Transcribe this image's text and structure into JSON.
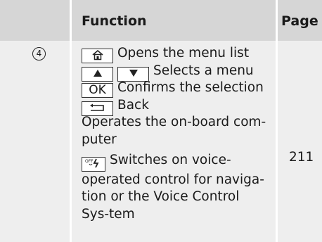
{
  "table": {
    "headers": {
      "number": "",
      "function": "Function",
      "page": "Page"
    },
    "row": {
      "number": "④",
      "lines": {
        "menu_list": "Opens the menu list",
        "selects": "Selects a menu",
        "confirms": "Confirms the selection",
        "back": "Back",
        "onboard": "Operates the on-board com-puter",
        "voice": "Switches on voice-operated control for naviga-tion or the Voice Control Sys-tem"
      },
      "keys": {
        "home": "⌂",
        "up": "▲",
        "down": "▼",
        "ok": "OK",
        "back": "⮌",
        "voice": "ᴼᶠᶠ ≋("
      },
      "page": "211"
    }
  }
}
